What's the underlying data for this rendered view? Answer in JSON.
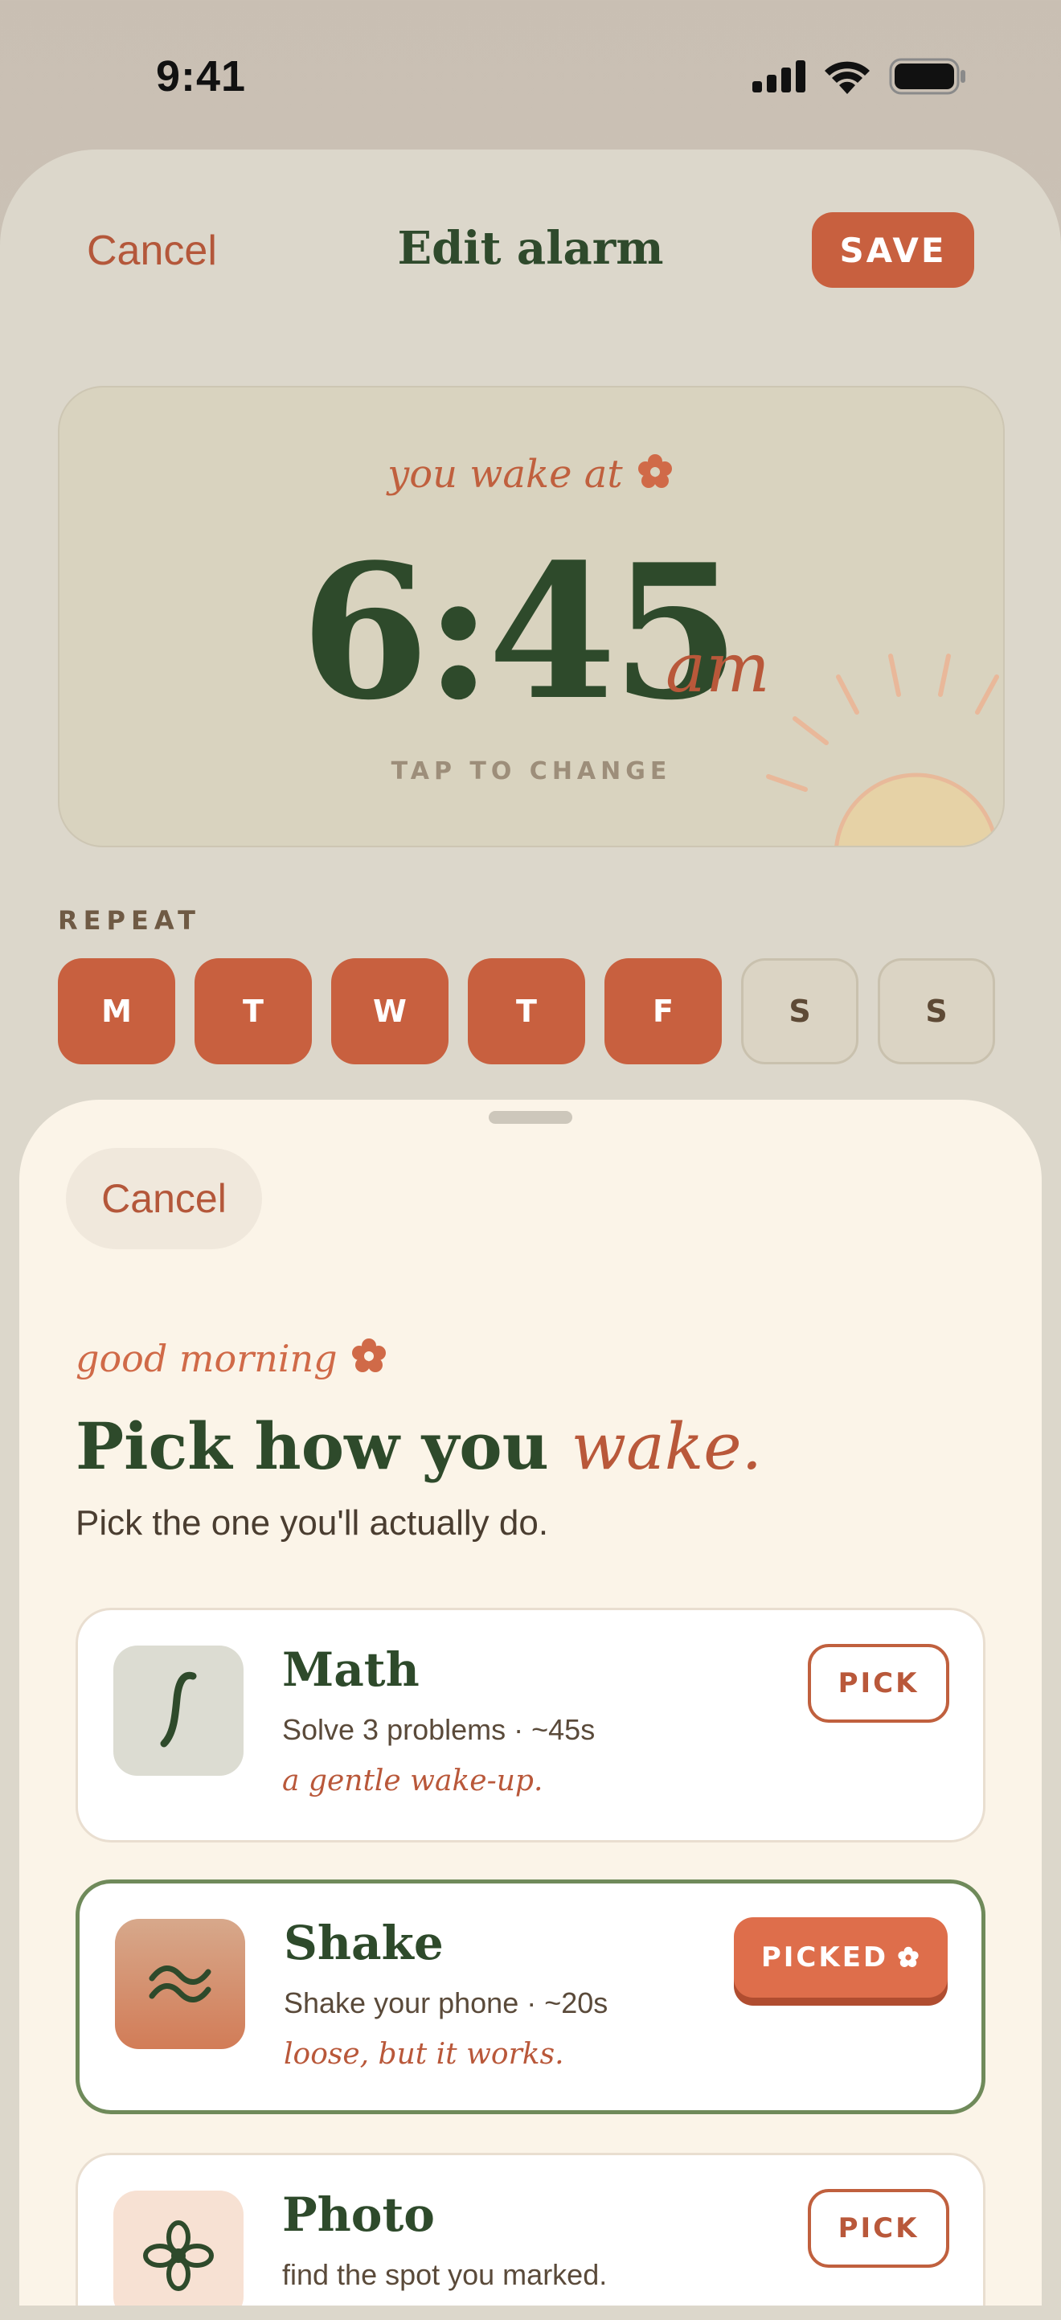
{
  "status_bar": {
    "time": "9:41"
  },
  "nav": {
    "cancel": "Cancel",
    "title": "Edit alarm",
    "save": "SAVE"
  },
  "alarm": {
    "wake_label": "you wake at",
    "time": "6:45",
    "ampm": "am",
    "tap_hint": "TAP TO CHANGE"
  },
  "repeat": {
    "label": "REPEAT",
    "days": [
      {
        "letter": "M",
        "selected": true
      },
      {
        "letter": "T",
        "selected": true
      },
      {
        "letter": "W",
        "selected": true
      },
      {
        "letter": "T",
        "selected": true
      },
      {
        "letter": "F",
        "selected": true
      },
      {
        "letter": "S",
        "selected": false
      },
      {
        "letter": "S",
        "selected": false
      }
    ]
  },
  "sheet": {
    "cancel": "Cancel",
    "greeting": "good morning",
    "headline_main": "Pick how you",
    "headline_accent": "wake.",
    "subtitle": "Pick the one you'll actually do.",
    "options": [
      {
        "title": "Math",
        "description": "Solve 3 problems · ~45s",
        "note": "a gentle wake-up.",
        "button": "PICK",
        "icon": "integral-icon",
        "selected": false
      },
      {
        "title": "Shake",
        "description": "Shake your phone · ~20s",
        "note": "loose, but it works.",
        "button": "PICKED",
        "icon": "wave-icon",
        "selected": true
      },
      {
        "title": "Photo",
        "description": "find the spot you marked.",
        "note": "",
        "button": "PICK",
        "icon": "flower-icon",
        "selected": false
      }
    ]
  },
  "colors": {
    "accent": "#c8603f",
    "green": "#2e4a2b",
    "selected_border": "#6f8a5a"
  }
}
